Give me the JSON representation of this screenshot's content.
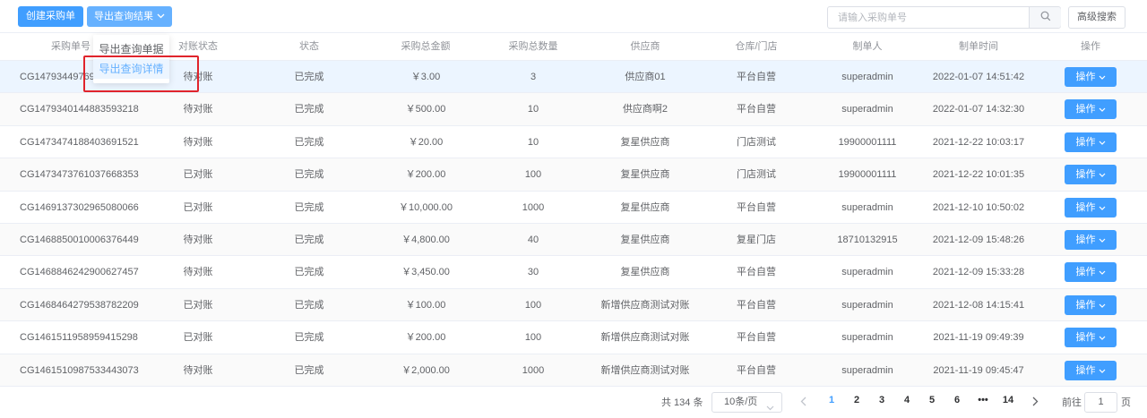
{
  "toolbar": {
    "create_label": "创建采购单",
    "export_label": "导出查询结果",
    "search_placeholder": "请输入采购单号",
    "advanced_label": "高级搜索"
  },
  "export_menu": {
    "items": [
      "导出查询单据",
      "导出查询详情"
    ]
  },
  "table": {
    "columns": [
      "采购单号",
      "对账状态",
      "状态",
      "采购总金额",
      "采购总数量",
      "供应商",
      "仓库/门店",
      "制单人",
      "制单时间",
      "操作"
    ],
    "rows": [
      {
        "order_no": "CG1479344976969",
        "recon": "待对账",
        "status": "已完成",
        "amount": "￥3.00",
        "qty": "3",
        "supplier": "供应商01",
        "store": "平台自营",
        "creator": "superadmin",
        "time": "2022-01-07 14:51:42",
        "action": "操作"
      },
      {
        "order_no": "CG1479340144883593218",
        "recon": "待对账",
        "status": "已完成",
        "amount": "￥500.00",
        "qty": "10",
        "supplier": "供应商啊2",
        "store": "平台自营",
        "creator": "superadmin",
        "time": "2022-01-07 14:32:30",
        "action": "操作"
      },
      {
        "order_no": "CG1473474188403691521",
        "recon": "待对账",
        "status": "已完成",
        "amount": "￥20.00",
        "qty": "10",
        "supplier": "复星供应商",
        "store": "门店测试",
        "creator": "19900001111",
        "time": "2021-12-22 10:03:17",
        "action": "操作"
      },
      {
        "order_no": "CG1473473761037668353",
        "recon": "已对账",
        "status": "已完成",
        "amount": "￥200.00",
        "qty": "100",
        "supplier": "复星供应商",
        "store": "门店测试",
        "creator": "19900001111",
        "time": "2021-12-22 10:01:35",
        "action": "操作"
      },
      {
        "order_no": "CG1469137302965080066",
        "recon": "已对账",
        "status": "已完成",
        "amount": "￥10,000.00",
        "qty": "1000",
        "supplier": "复星供应商",
        "store": "平台自营",
        "creator": "superadmin",
        "time": "2021-12-10 10:50:02",
        "action": "操作"
      },
      {
        "order_no": "CG1468850010006376449",
        "recon": "待对账",
        "status": "已完成",
        "amount": "￥4,800.00",
        "qty": "40",
        "supplier": "复星供应商",
        "store": "复星门店",
        "creator": "18710132915",
        "time": "2021-12-09 15:48:26",
        "action": "操作"
      },
      {
        "order_no": "CG1468846242900627457",
        "recon": "待对账",
        "status": "已完成",
        "amount": "￥3,450.00",
        "qty": "30",
        "supplier": "复星供应商",
        "store": "平台自营",
        "creator": "superadmin",
        "time": "2021-12-09 15:33:28",
        "action": "操作"
      },
      {
        "order_no": "CG1468464279538782209",
        "recon": "已对账",
        "status": "已完成",
        "amount": "￥100.00",
        "qty": "100",
        "supplier": "新增供应商测试对账",
        "store": "平台自营",
        "creator": "superadmin",
        "time": "2021-12-08 14:15:41",
        "action": "操作"
      },
      {
        "order_no": "CG1461511958959415298",
        "recon": "已对账",
        "status": "已完成",
        "amount": "￥200.00",
        "qty": "100",
        "supplier": "新增供应商测试对账",
        "store": "平台自营",
        "creator": "superadmin",
        "time": "2021-11-19 09:49:39",
        "action": "操作"
      },
      {
        "order_no": "CG1461510987533443073",
        "recon": "待对账",
        "status": "已完成",
        "amount": "￥2,000.00",
        "qty": "1000",
        "supplier": "新增供应商测试对账",
        "store": "平台自营",
        "creator": "superadmin",
        "time": "2021-11-19 09:45:47",
        "action": "操作"
      }
    ]
  },
  "pagination": {
    "total": "共 134 条",
    "page_size": "10条/页",
    "pages": [
      "1",
      "2",
      "3",
      "4",
      "5",
      "6",
      "•••",
      "14"
    ],
    "current": "1",
    "goto_label": "前往",
    "goto_value": "1",
    "page_suffix": "页"
  },
  "colors": {
    "primary": "#409eff",
    "highlight_box": "#e0242c",
    "row_hover": "#ecf5ff"
  },
  "icons": [
    "chevron-down-icon",
    "search-icon",
    "chevron-left-icon",
    "chevron-right-icon"
  ]
}
